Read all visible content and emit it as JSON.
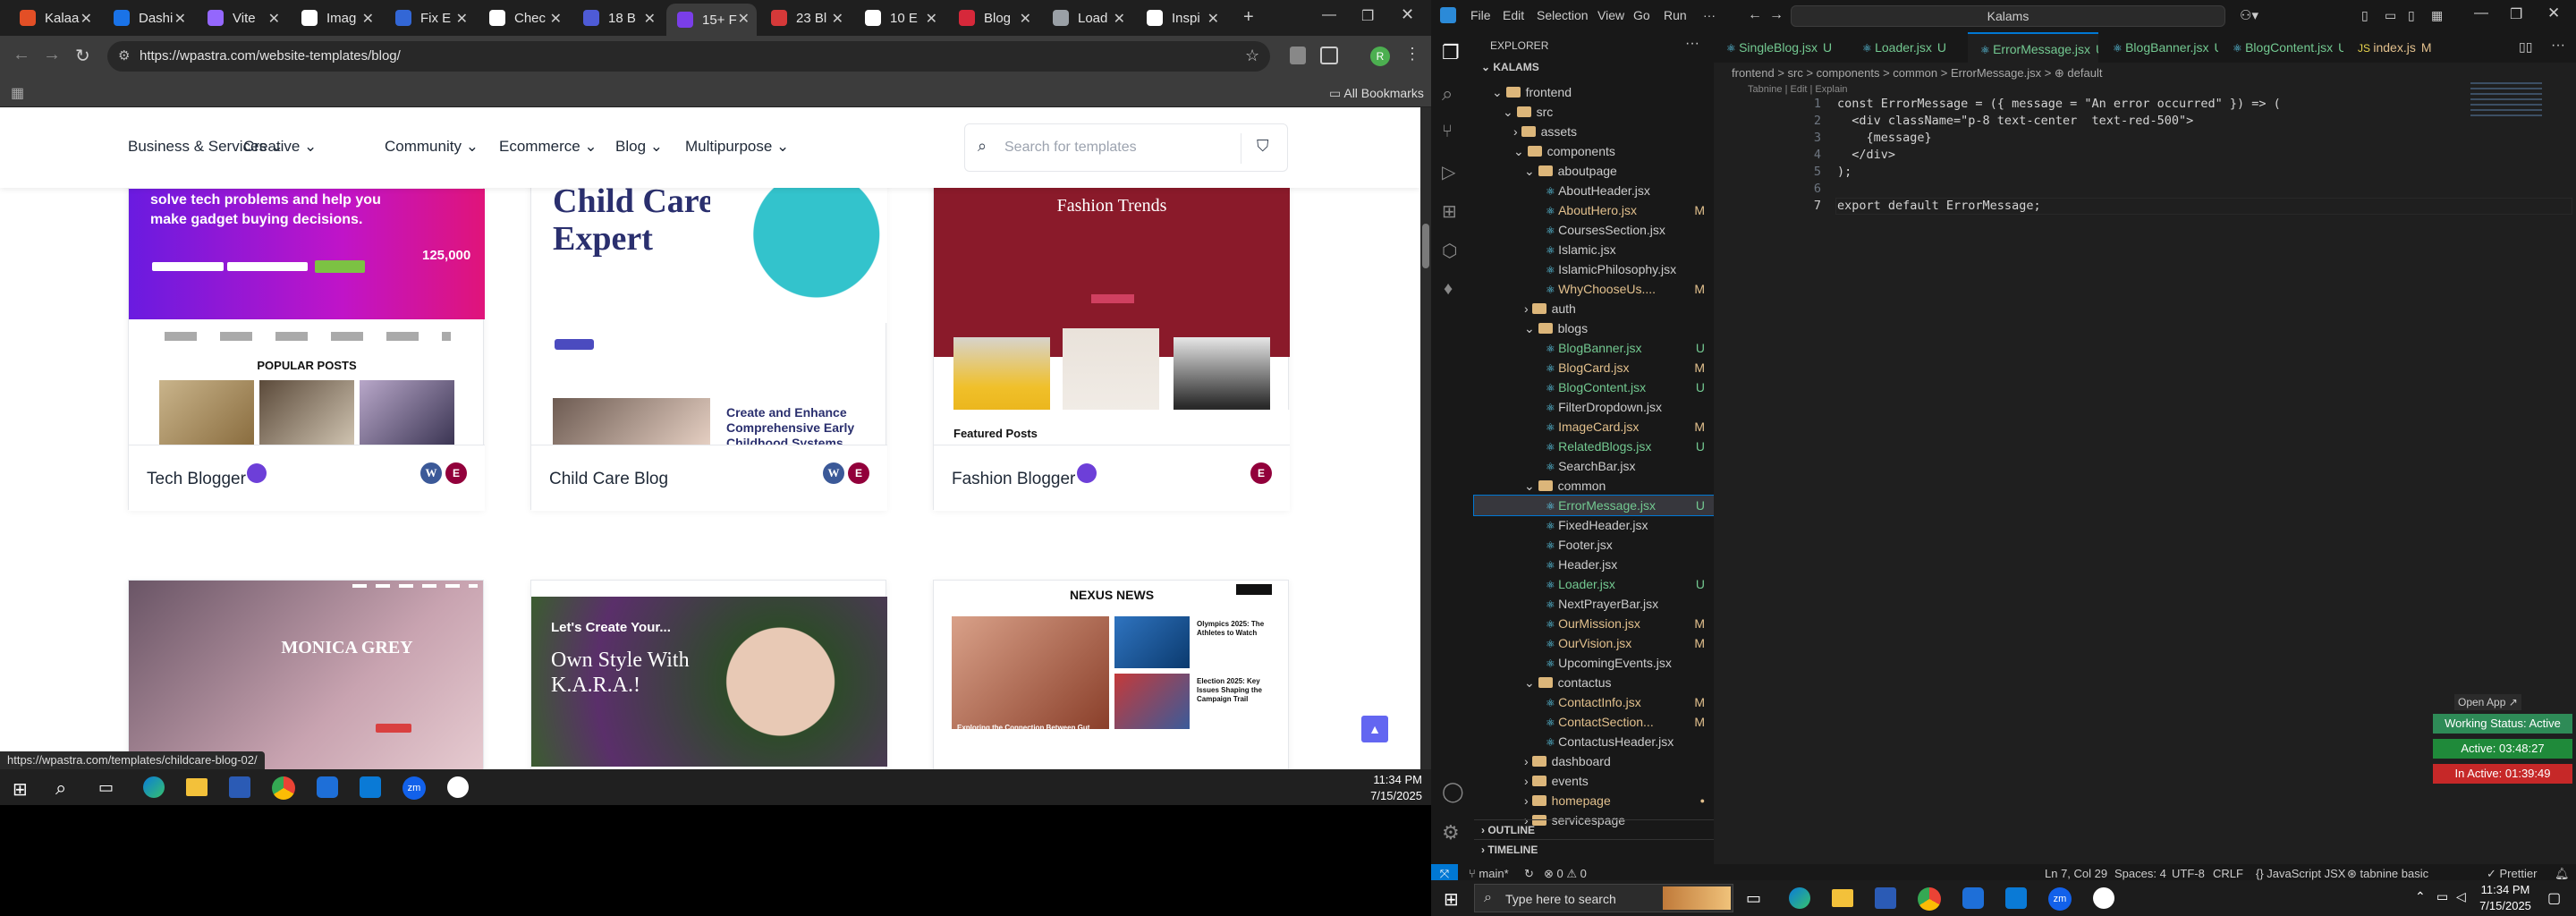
{
  "browser": {
    "tabs": [
      {
        "label": "Kalaa",
        "color": "#e34f26"
      },
      {
        "label": "Dashi",
        "color": "#1a73e8"
      },
      {
        "label": "Vite",
        "color": "#9467fd"
      },
      {
        "label": "Imag",
        "color": "#ffffff"
      },
      {
        "label": "Fix E",
        "color": "#3367d6"
      },
      {
        "label": "Chec",
        "color": "#ffffff"
      },
      {
        "label": "18 B",
        "color": "#4e5bd6"
      },
      {
        "label": "15+ F",
        "color": "#7a3ee8"
      },
      {
        "label": "23 Bl",
        "color": "#d63939"
      },
      {
        "label": "10 E",
        "color": "#ffffff"
      },
      {
        "label": "Blog",
        "color": "#d6283a"
      },
      {
        "label": "Load",
        "color": "#9aa0a6"
      },
      {
        "label": "Inspi",
        "color": "#ffffff"
      }
    ],
    "new_tab": "+",
    "url": "https://wpastra.com/website-templates/blog/",
    "bookmarks": "All Bookmarks",
    "hover_url": "https://wpastra.com/templates/childcare-blog-02/"
  },
  "site": {
    "nav": [
      "Business & Services",
      "Creative",
      "Community",
      "Ecommerce",
      "Blog",
      "Multipurpose"
    ],
    "search_placeholder": "Search for templates",
    "cards": [
      {
        "name": "Tech Blogger",
        "banner1": "solve tech problems and help you",
        "banner2": "make gadget buying decisions.",
        "stat": "125,000",
        "section": "POPULAR POSTS"
      },
      {
        "name": "Child Care Blog",
        "hero": "Child Care",
        "hero2": "Expert",
        "section": "Create and Enhance Comprehensive Early Childhood Systems"
      },
      {
        "name": "Fashion Blogger",
        "hero": "Fashion Trends",
        "section": "Featured Posts"
      },
      {
        "name": "Monica Grey",
        "hero": "MONICA GREY"
      },
      {
        "name": "K.A.R.A",
        "hero": "Let's Create Your...",
        "hero2": "Own Style With",
        "hero3": "K.A.R.A.!"
      },
      {
        "name": "Nexus News",
        "hero": "NEXUS NEWS",
        "s1": "Olympics 2025: The Athletes to Watch",
        "s2": "Exploring the Connection Between Gut Health and Mental Well-being",
        "s3": "Election 2025: Key Issues Shaping the Campaign Trail"
      }
    ]
  },
  "left_taskbar": {
    "time": "11:34 PM",
    "date": "7/15/2025"
  },
  "vscode": {
    "menu": [
      "File",
      "Edit",
      "Selection",
      "View",
      "Go",
      "Run",
      "···"
    ],
    "search": "Kalams",
    "explorer_title": "EXPLORER",
    "root": "KALAMS",
    "tree": [
      {
        "d": 1,
        "t": "f",
        "open": true,
        "n": "frontend",
        "s": "",
        "c": "#ccc"
      },
      {
        "d": 2,
        "t": "f",
        "open": true,
        "n": "src",
        "s": "",
        "c": "#ccc"
      },
      {
        "d": 3,
        "t": "f",
        "open": false,
        "n": "assets",
        "s": "",
        "c": "#ccc"
      },
      {
        "d": 3,
        "t": "f",
        "open": true,
        "n": "components",
        "s": "",
        "c": "#ccc"
      },
      {
        "d": 4,
        "t": "f",
        "open": true,
        "n": "aboutpage",
        "s": "",
        "c": "#ccc"
      },
      {
        "d": 5,
        "t": "x",
        "n": "AboutHeader.jsx",
        "s": "",
        "c": "#ccc"
      },
      {
        "d": 5,
        "t": "x",
        "n": "AboutHero.jsx",
        "s": "M",
        "c": "#e2c08d"
      },
      {
        "d": 5,
        "t": "x",
        "n": "CoursesSection.jsx",
        "s": "",
        "c": "#ccc"
      },
      {
        "d": 5,
        "t": "x",
        "n": "Islamic.jsx",
        "s": "",
        "c": "#ccc"
      },
      {
        "d": 5,
        "t": "x",
        "n": "IslamicPhilosophy.jsx",
        "s": "",
        "c": "#ccc"
      },
      {
        "d": 5,
        "t": "x",
        "n": "WhyChooseUs....",
        "s": "M",
        "c": "#e2c08d"
      },
      {
        "d": 4,
        "t": "f",
        "open": false,
        "n": "auth",
        "s": "",
        "c": "#ccc"
      },
      {
        "d": 4,
        "t": "f",
        "open": true,
        "n": "blogs",
        "s": "",
        "c": "#ccc"
      },
      {
        "d": 5,
        "t": "x",
        "n": "BlogBanner.jsx",
        "s": "U",
        "c": "#73c991"
      },
      {
        "d": 5,
        "t": "x",
        "n": "BlogCard.jsx",
        "s": "M",
        "c": "#e2c08d"
      },
      {
        "d": 5,
        "t": "x",
        "n": "BlogContent.jsx",
        "s": "U",
        "c": "#73c991"
      },
      {
        "d": 5,
        "t": "x",
        "n": "FilterDropdown.jsx",
        "s": "",
        "c": "#ccc"
      },
      {
        "d": 5,
        "t": "x",
        "n": "ImageCard.jsx",
        "s": "M",
        "c": "#e2c08d"
      },
      {
        "d": 5,
        "t": "x",
        "n": "RelatedBlogs.jsx",
        "s": "U",
        "c": "#73c991"
      },
      {
        "d": 5,
        "t": "x",
        "n": "SearchBar.jsx",
        "s": "",
        "c": "#ccc"
      },
      {
        "d": 4,
        "t": "f",
        "open": true,
        "n": "common",
        "s": "",
        "c": "#ccc"
      },
      {
        "d": 5,
        "t": "x",
        "n": "ErrorMessage.jsx",
        "s": "U",
        "c": "#73c991",
        "sel": true
      },
      {
        "d": 5,
        "t": "x",
        "n": "FixedHeader.jsx",
        "s": "",
        "c": "#ccc"
      },
      {
        "d": 5,
        "t": "x",
        "n": "Footer.jsx",
        "s": "",
        "c": "#ccc"
      },
      {
        "d": 5,
        "t": "x",
        "n": "Header.jsx",
        "s": "",
        "c": "#ccc"
      },
      {
        "d": 5,
        "t": "x",
        "n": "Loader.jsx",
        "s": "U",
        "c": "#73c991"
      },
      {
        "d": 5,
        "t": "x",
        "n": "NextPrayerBar.jsx",
        "s": "",
        "c": "#ccc"
      },
      {
        "d": 5,
        "t": "x",
        "n": "OurMission.jsx",
        "s": "M",
        "c": "#e2c08d"
      },
      {
        "d": 5,
        "t": "x",
        "n": "OurVision.jsx",
        "s": "M",
        "c": "#e2c08d"
      },
      {
        "d": 5,
        "t": "x",
        "n": "UpcomingEvents.jsx",
        "s": "",
        "c": "#ccc"
      },
      {
        "d": 4,
        "t": "f",
        "open": true,
        "n": "contactus",
        "s": "",
        "c": "#ccc"
      },
      {
        "d": 5,
        "t": "x",
        "n": "ContactInfo.jsx",
        "s": "M",
        "c": "#e2c08d"
      },
      {
        "d": 5,
        "t": "x",
        "n": "ContactSection...",
        "s": "M",
        "c": "#e2c08d"
      },
      {
        "d": 5,
        "t": "x",
        "n": "ContactusHeader.jsx",
        "s": "",
        "c": "#ccc"
      },
      {
        "d": 4,
        "t": "f",
        "open": false,
        "n": "dashboard",
        "s": "",
        "c": "#ccc"
      },
      {
        "d": 4,
        "t": "f",
        "open": false,
        "n": "events",
        "s": "",
        "c": "#ccc"
      },
      {
        "d": 4,
        "t": "f",
        "open": false,
        "n": "homepage",
        "s": "",
        "c": "#e2c08d"
      },
      {
        "d": 4,
        "t": "f",
        "open": false,
        "n": "servicespage",
        "s": "",
        "c": "#ccc"
      }
    ],
    "outline": "OUTLINE",
    "timeline": "TIMELINE",
    "tabs": [
      {
        "n": "SingleBlog.jsx",
        "s": "U"
      },
      {
        "n": "Loader.jsx",
        "s": "U"
      },
      {
        "n": "ErrorMessage.jsx",
        "s": "U",
        "active": true
      },
      {
        "n": "BlogBanner.jsx",
        "s": "U"
      },
      {
        "n": "BlogContent.jsx",
        "s": "U"
      },
      {
        "n": "index.js",
        "s": "M"
      }
    ],
    "breadcrumb": "frontend > src > components > common > ErrorMessage.jsx > ⊕ default",
    "codelens": "Tabnine | Edit | Explain",
    "lines": [
      "const ErrorMessage = ({ message = \"An error occurred\" }) => (",
      "  <div className=\"p-8 text-center  text-red-500\">",
      "    {message}",
      "  </div>",
      ");",
      "",
      "export default ErrorMessage;"
    ],
    "open_app": "Open App ↗",
    "working_status": "Working Status: Active",
    "active_time": "Active: 03:48:27",
    "inactive_time": "In Active: 01:39:49",
    "status": {
      "branch": "main*",
      "problems": "⊗ 0 ⚠ 0",
      "pos": "Ln 7, Col 29",
      "spaces": "Spaces: 4",
      "enc": "UTF-8",
      "eol": "CRLF",
      "lang": "{} JavaScript JSX",
      "tabnine": "tabnine basic",
      "prettier": "✓ Prettier"
    }
  },
  "right_taskbar": {
    "search": "Type here to search",
    "time": "11:34 PM",
    "date": "7/15/2025"
  }
}
